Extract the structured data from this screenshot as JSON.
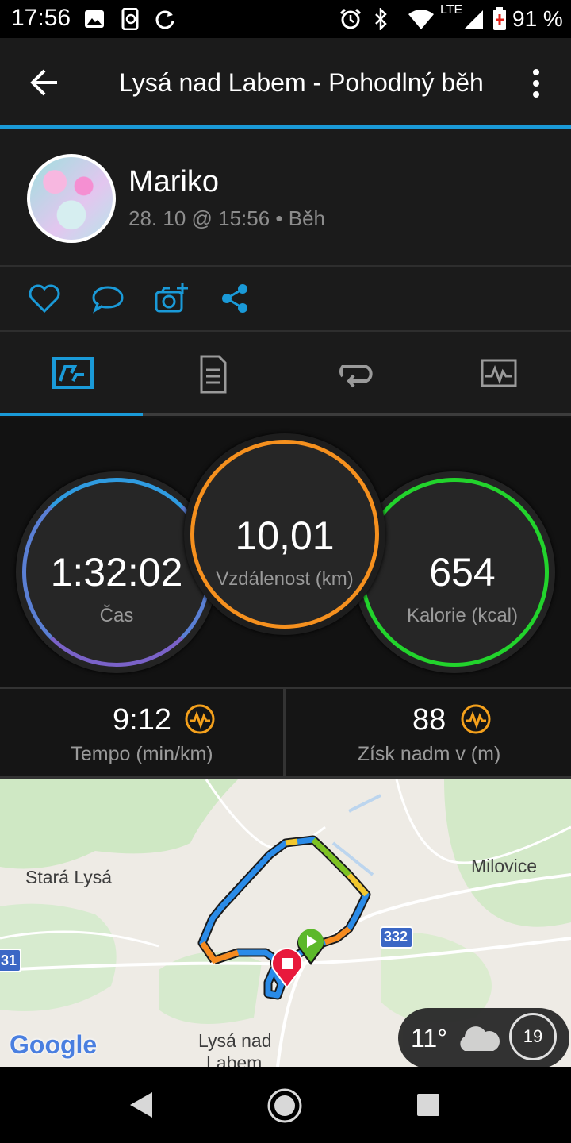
{
  "status_bar": {
    "time": "17:56",
    "network": "LTE",
    "battery": "91 %"
  },
  "app_bar": {
    "title": "Lysá nad Labem - Pohodlný běh"
  },
  "profile": {
    "name": "Mariko",
    "meta": "28. 10 @ 15:56 • Běh"
  },
  "stats": {
    "time": {
      "value": "1:32:02",
      "label": "Čas"
    },
    "distance": {
      "value": "10,01",
      "label": "Vzdálenost (km)"
    },
    "calories": {
      "value": "654",
      "label": "Kalorie (kcal)"
    }
  },
  "sub_stats": {
    "pace": {
      "value": "9:12",
      "label": "Tempo (min/km)"
    },
    "elevation": {
      "value": "88",
      "label": "Získ nadm v (m)"
    }
  },
  "map": {
    "labels": {
      "stara_lysa": "Stará Lysá",
      "milovice": "Milovice",
      "lysa_line1": "Lysá nad",
      "lysa_line2": "Labem",
      "road_332": "332",
      "road_31": "31",
      "google": "Google"
    },
    "weather": {
      "temp": "11°",
      "wind": "19"
    }
  },
  "colors": {
    "accent": "#1a9ad8",
    "time_ring_top": "#2f9be0",
    "time_ring_bottom": "#7a62c8",
    "distance_ring": "#f5901e",
    "calories_ring": "#22d32c",
    "badge_icon": "#f5a11c"
  }
}
